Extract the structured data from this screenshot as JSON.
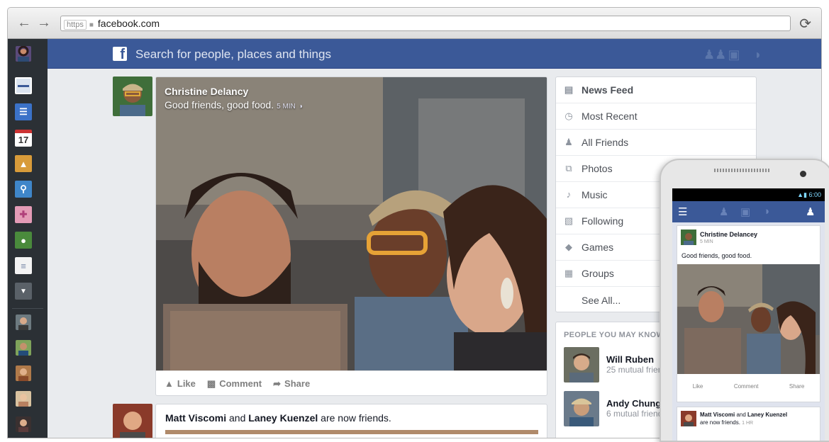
{
  "browser": {
    "url_scheme": "https",
    "url": "facebook.com"
  },
  "topbar": {
    "search_placeholder": "Search for people, places and things"
  },
  "rail": {
    "calendar_day": "17"
  },
  "post": {
    "author": "Christine Delancy",
    "text": "Good friends, good food.",
    "time": "5 MIN",
    "actions": {
      "like": "Like",
      "comment": "Comment",
      "share": "Share"
    }
  },
  "post2": {
    "name1": "Matt Viscomi",
    "connector": "and",
    "name2": "Laney Kuenzel",
    "suffix": "are now friends."
  },
  "menu": {
    "items": [
      "News Feed",
      "Most Recent",
      "All Friends",
      "Photos",
      "Music",
      "Following",
      "Games",
      "Groups"
    ],
    "see_all": "See All..."
  },
  "pymk": {
    "title": "PEOPLE YOU MAY KNOW",
    "people": [
      {
        "name": "Will Ruben",
        "mutual": "25 mutual friends"
      },
      {
        "name": "Andy Chung",
        "mutual": "6 mutual friends"
      }
    ]
  },
  "phone": {
    "clock": "6:00",
    "author": "Christine Delancey",
    "time": "5 MIN",
    "text": "Good friends, good food.",
    "actions": {
      "like": "Like",
      "comment": "Comment",
      "share": "Share"
    },
    "post2": {
      "name1": "Matt Viscomi",
      "connector": "and",
      "name2": "Laney Kuenzel",
      "suffix": "are now friends.",
      "time": "1 HR"
    }
  },
  "colors": {
    "brand": "#3b5998",
    "rail": "#2b3035",
    "background": "#e9ebee"
  }
}
